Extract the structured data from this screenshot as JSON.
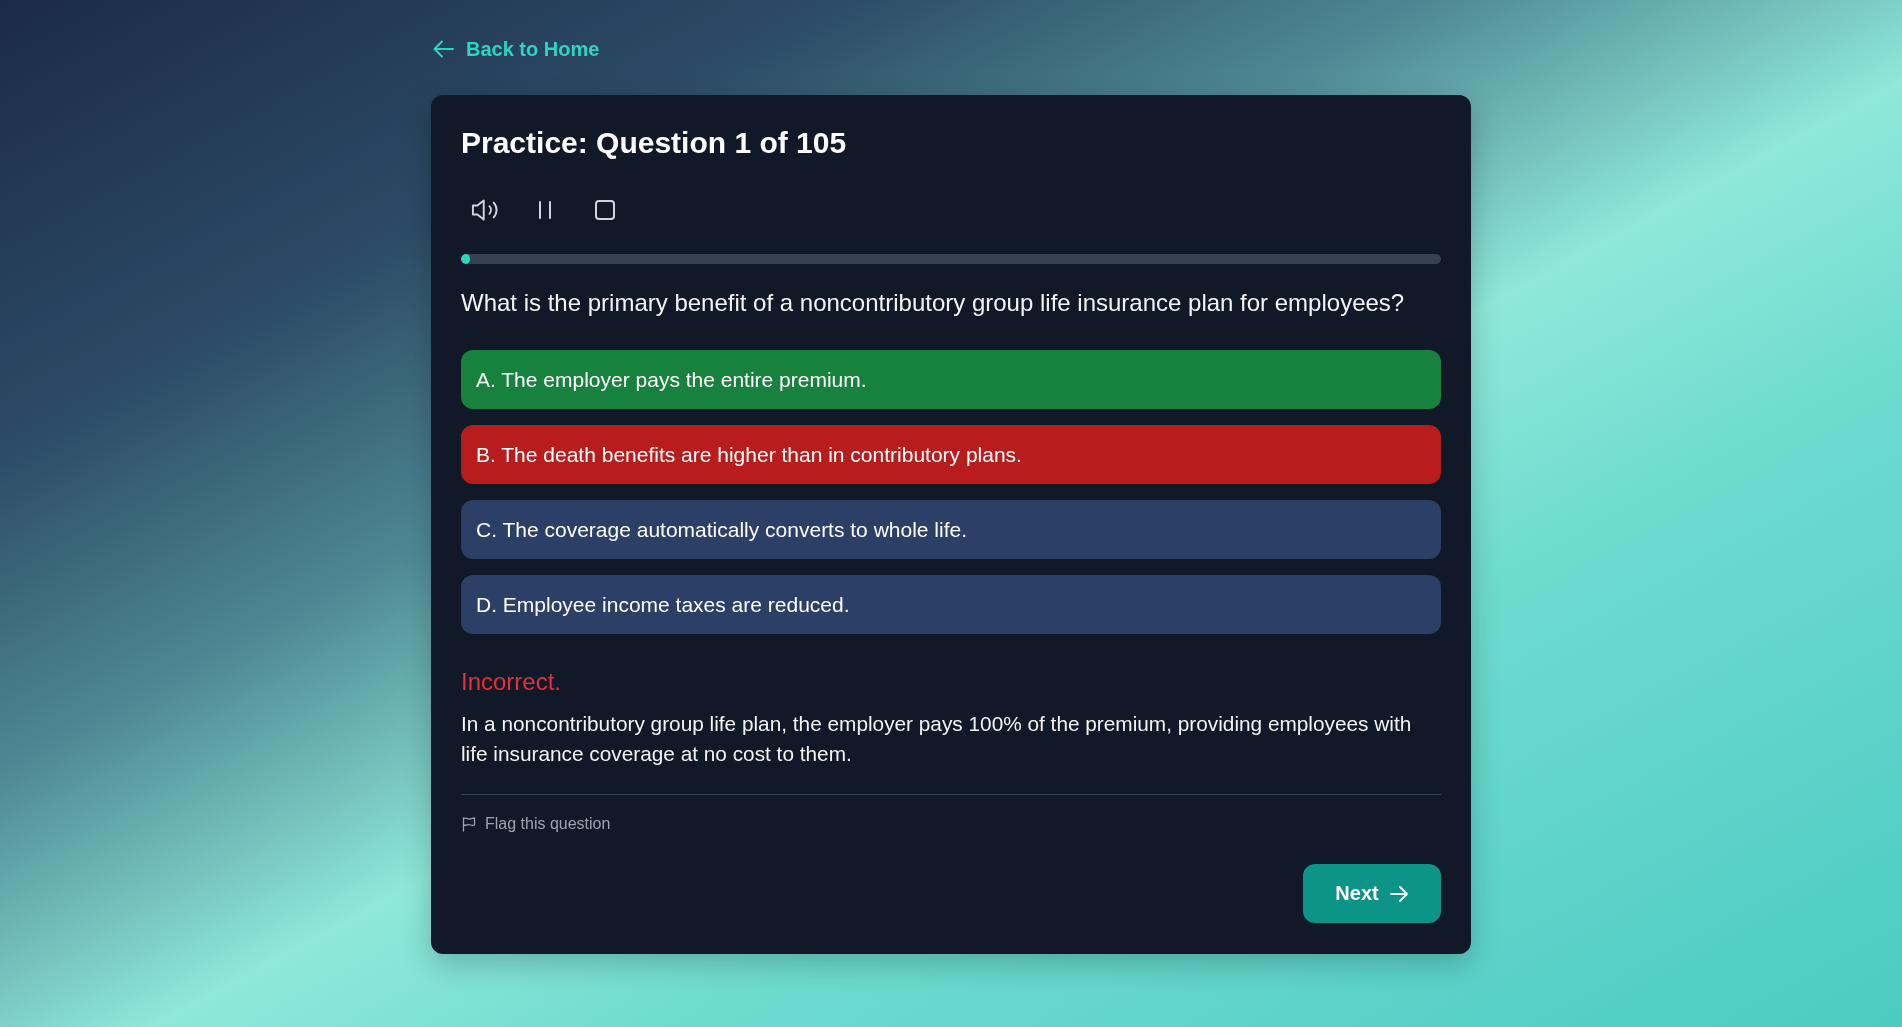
{
  "back_link": {
    "label": "Back to Home"
  },
  "quiz": {
    "title": "Practice: Question 1 of 105",
    "progress": {
      "level": 0.0095
    },
    "question": "What is the primary benefit of a noncontributory group life insurance plan for employees?",
    "options": [
      {
        "text": "A. The employer pays the entire premium.",
        "selected": false,
        "correct": true
      },
      {
        "text": "B. The death benefits are higher than in contributory plans.",
        "selected": true,
        "correct": false
      },
      {
        "text": "C. The coverage automatically converts to whole life.",
        "selected": false,
        "correct": false
      },
      {
        "text": "D. Employee income taxes are reduced.",
        "selected": false,
        "correct": false
      }
    ],
    "feedback": {
      "verdict": "Incorrect.",
      "correct": false,
      "explanation": "In a noncontributory group life plan, the employer pays 100% of the premium, providing employees with life insurance coverage at no cost to them."
    },
    "flag": {
      "label": "Flag this question"
    },
    "next_button": {
      "label": "Next"
    }
  }
}
